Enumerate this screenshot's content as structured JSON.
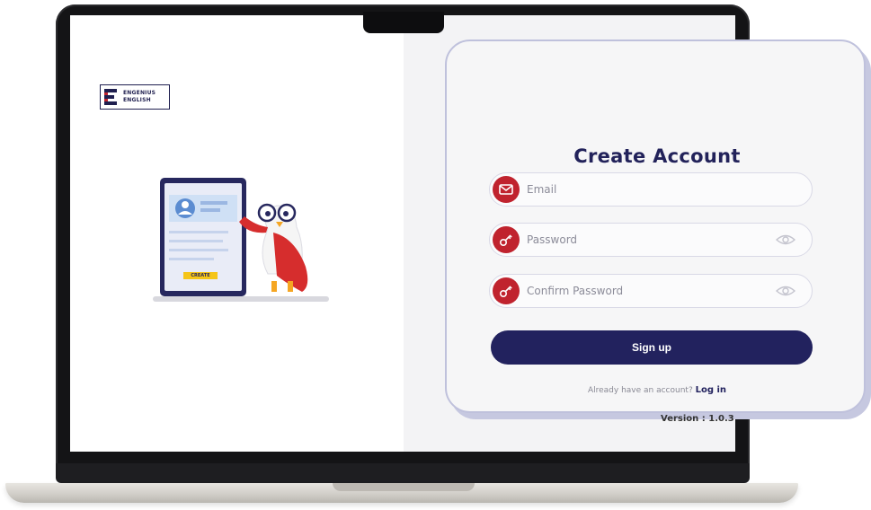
{
  "brand": {
    "line1": "ENGENIUS",
    "line2": "ENGLISH"
  },
  "illustration": {
    "create_button_label": "CREATE"
  },
  "form": {
    "title": "Create Account",
    "email_placeholder": "Email",
    "password_placeholder": "Password",
    "confirm_password_placeholder": "Confirm Password",
    "signup_label": "Sign up",
    "login_prompt": "Already have an account?",
    "login_link": "Log in"
  },
  "version": "Version : 1.0.3",
  "colors": {
    "brand_navy": "#22225e",
    "accent_red": "#c0232e",
    "card_border": "#bfc1dc"
  },
  "icons": [
    "email-icon",
    "key-icon",
    "eye-icon"
  ]
}
